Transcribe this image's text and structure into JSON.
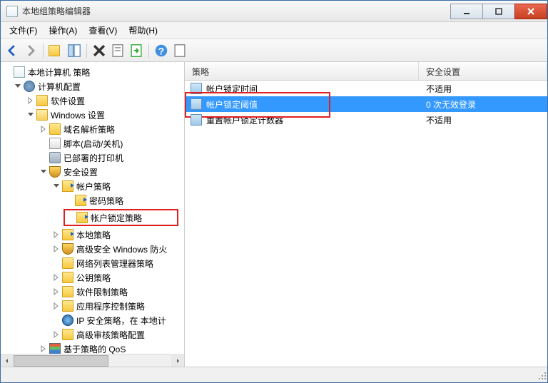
{
  "window": {
    "title": "本地组策略编辑器"
  },
  "menu": {
    "file": "文件(F)",
    "action": "操作(A)",
    "view": "查看(V)",
    "help": "帮助(H)"
  },
  "tree": {
    "root": "本地计算机 策略",
    "computer_config": "计算机配置",
    "software_settings": "软件设置",
    "windows_settings": "Windows 设置",
    "dns_policy": "域名解析策略",
    "scripts": "脚本(启动/关机)",
    "printers": "已部署的打印机",
    "security_settings": "安全设置",
    "account_policies": "帐户策略",
    "password_policy": "密码策略",
    "lockout_policy": "帐户锁定策略",
    "local_policies": "本地策略",
    "windows_firewall": "高级安全 Windows 防火",
    "network_list": "网络列表管理器策略",
    "public_key": "公钥策略",
    "software_restriction": "软件限制策略",
    "app_control": "应用程序控制策略",
    "ip_security": "IP 安全策略，在 本地计",
    "advanced_audit": "高级审核策略配置",
    "qos": "基于策略的 QoS"
  },
  "list": {
    "col_policy": "策略",
    "col_setting": "安全设置",
    "rows": [
      {
        "policy": "帐户锁定时间",
        "setting": "不适用"
      },
      {
        "policy": "帐户锁定阈值",
        "setting": "0 次无效登录"
      },
      {
        "policy": "重置帐户锁定计数器",
        "setting": "不适用"
      }
    ]
  }
}
